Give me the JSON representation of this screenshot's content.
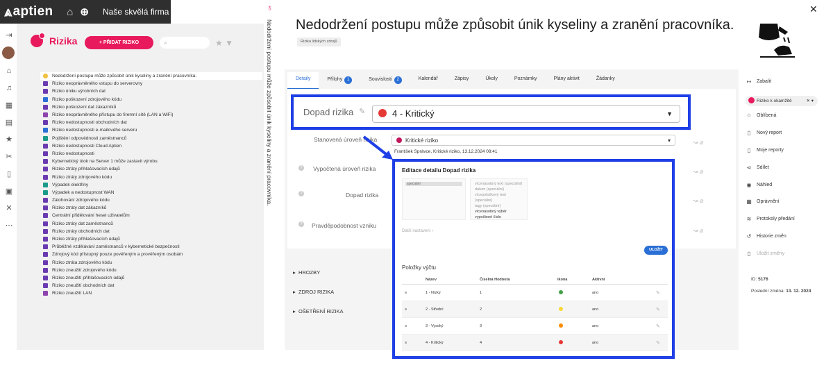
{
  "app": {
    "brand": "aptien",
    "company": "Naše skvělá firma"
  },
  "left": {
    "section_title": "Rizika",
    "add_button": "+ PŘIDAT RIZIKO",
    "search_placeholder": "",
    "items": [
      "Nedodržení postupu může způsobit únik kyseliny a zranění pracovníka.",
      "Riziko neoprávněného vstupu do serverovny",
      "Riziko úniku výrobních dat",
      "Riziko poškození zdrojového kódu",
      "Riziko poškození dat zákazníků",
      "Riziko neoprávněného přístupu do firemní sítě (LAN a WiFi)",
      "Riziko nedostupnosti obchodních dat",
      "Riziko nedostupnosti e-mailového serveru",
      "Pojištění odpovědnosti zaměstnanců",
      "Riziko nedostupnosti Cloud Aptien",
      "Riziko nedostupnosti",
      "Kybernetický útok na Server 1 může zastavit výrobu",
      "Riziko ztráty přihlašovacích údajů",
      "Riziko ztráty zdrojového kódu",
      "Výpadek elektřiny",
      "Výpadek a nedostupnost WAN",
      "Zálohování zdrojového kódu",
      "Riziko ztráty dat zákazníků",
      "Centrální přidělování hesel uživatelům",
      "Riziko ztráty dat zaměstnanců",
      "Riziko ztráty obchodních dat",
      "Riziko ztráty přihlašovacích údajů",
      "Průběžné vzdělávání zaměstnanců v kybernetické bezpečnosti",
      "Zdrojový kód přístupný pouze pověřeným a prověřeným osobám",
      "Riziko ztráta zdrojového kódu",
      "Riziko zneužití zdrojového kódu",
      "Riziko zneužití přihlašovacích údajů",
      "Riziko zneužití obchodních dat",
      "Riziko zneužití LAN"
    ]
  },
  "vertical_title": "Nedodržení postupu může způsobit únik kyseliny a zranění pracovníka.",
  "detail": {
    "title": "Nedodržení postupu může způsobit únik kyseliny a zranění pracovníka.",
    "tag": "Rizika lidských zdrojů",
    "tabs": [
      {
        "label": "Detaily",
        "badge": ""
      },
      {
        "label": "Přílohy",
        "badge": "1"
      },
      {
        "label": "Souvislosti",
        "badge": "2"
      },
      {
        "label": "Kalendář",
        "badge": ""
      },
      {
        "label": "Zápisy",
        "badge": ""
      },
      {
        "label": "Úkoly",
        "badge": ""
      },
      {
        "label": "Poznámky",
        "badge": ""
      },
      {
        "label": "Plány aktivit",
        "badge": ""
      },
      {
        "label": "Žádanky",
        "badge": ""
      }
    ],
    "dopad_label": "Dopad rizika",
    "dopad_value": "4 - Kritický",
    "stanovena_label": "Stanovená úroveň rizika",
    "stanovena_value": "Kritické riziko",
    "stanovena_meta": "František Správce, Kritické riziko, 13.12.2024 08:41",
    "vypoctena_label": "Vypočtená úroveň rizika",
    "dopad2_label": "Dopad rizika",
    "pravd_label": "Pravděpodobnost vzniku",
    "accordions": [
      "HROZBY",
      "ZDROJ RIZIKA",
      "OŠETŘENÍ RIZIKA"
    ]
  },
  "modal": {
    "title": "Editace detailu Dopad rizika",
    "left_chip": "speciální",
    "options": [
      "vícenásobný text (speciální)",
      "datum (speciální)",
      "vícepoložkový text (speciální)",
      "tagy (speciální)",
      "vícenásobný výběr",
      "vypočtené číslo"
    ],
    "more_settings": "Další nastavení  ›",
    "save": "ULOŽIT",
    "list_title": "Položky výčtu",
    "headers": [
      "Název",
      "Číselná Hodnota",
      "Ikona",
      "Aktivní"
    ],
    "rows": [
      {
        "name": "1 - Nízký",
        "value": "1",
        "color": "#43a047",
        "active": "ano"
      },
      {
        "name": "2 - Střední",
        "value": "2",
        "color": "#fdd835",
        "active": "ano"
      },
      {
        "name": "3 - Vysoký",
        "value": "3",
        "color": "#fb8c00",
        "active": "ano"
      },
      {
        "name": "4 - Kritický",
        "value": "4",
        "color": "#e53935",
        "active": "ano"
      }
    ]
  },
  "right": {
    "collapse": "Zabalit",
    "status": "Riziko k okamžitě",
    "items": [
      "Oblíbená",
      "Nový report",
      "Moje reporty",
      "Sdílet",
      "Náhled",
      "Oprávnění",
      "Protokoly předání",
      "Historie změn",
      "Uložit změny"
    ],
    "id_label": "ID:",
    "id_value": "5176",
    "changed_label": "Poslední změna:",
    "changed_value": "13. 12. 2024"
  }
}
